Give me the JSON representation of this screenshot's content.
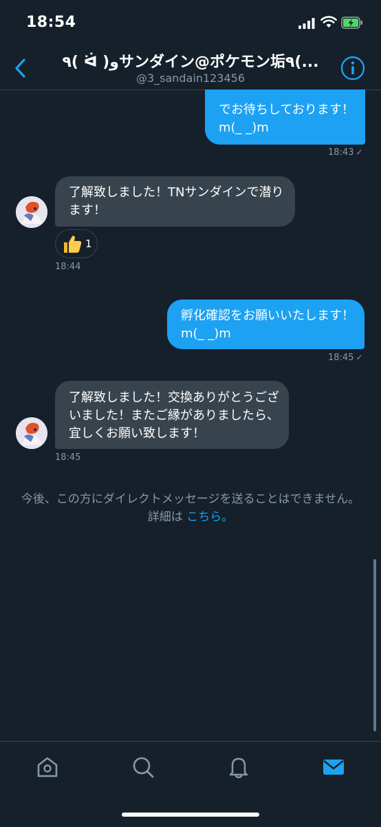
{
  "status": {
    "time": "18:54"
  },
  "header": {
    "title": "٩( ᐛ )وサンダイン@ポケモン垢٩(...",
    "handle": "@3_sandain123456"
  },
  "messages": [
    {
      "side": "sent",
      "lines": [
        "でお待ちしております！",
        "m(_ _)m"
      ],
      "time": "18:43",
      "check": "✓"
    },
    {
      "side": "received",
      "lines": [
        "了解致しました！TNサンダインで潜り",
        "ます！"
      ],
      "time": "18:44",
      "reaction": {
        "emoji": "👍",
        "count": "1"
      }
    },
    {
      "side": "sent",
      "lines": [
        "孵化確認をお願いいたします！",
        "m(_ _)m"
      ],
      "time": "18:45",
      "check": "✓"
    },
    {
      "side": "received",
      "lines": [
        "了解致しました！交換ありがとうござ",
        "いました！またご縁がありましたら、",
        "宜しくお願い致します！"
      ],
      "time": "18:45"
    }
  ],
  "notice": {
    "text": "今後、この方にダイレクトメッセージを送ることはできません。",
    "details_label": "詳細は",
    "link_label": "こちら。"
  },
  "tabs": [
    {
      "name": "home",
      "icon": "home-icon",
      "active": false
    },
    {
      "name": "search",
      "icon": "search-icon",
      "active": false
    },
    {
      "name": "notifications",
      "icon": "bell-icon",
      "active": false
    },
    {
      "name": "messages",
      "icon": "mail-icon",
      "active": true
    }
  ],
  "colors": {
    "background": "#15202b",
    "accent": "#1da1f2",
    "received_bubble": "#38444d",
    "muted": "#8899a6"
  }
}
